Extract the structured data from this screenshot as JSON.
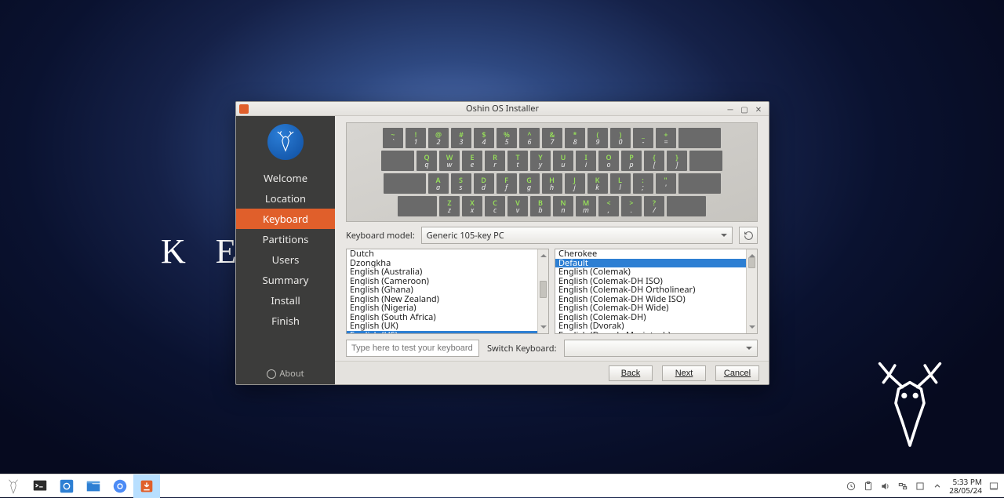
{
  "bgtext": "KE",
  "window": {
    "title": "Oshin OS Installer"
  },
  "sidebar": {
    "steps": [
      "Welcome",
      "Location",
      "Keyboard",
      "Partitions",
      "Users",
      "Summary",
      "Install",
      "Finish"
    ],
    "active_index": 2,
    "about": "About"
  },
  "keyboard_preview": {
    "row1": [
      [
        "~",
        "`"
      ],
      [
        "!",
        "1"
      ],
      [
        "@",
        "2"
      ],
      [
        "#",
        "3"
      ],
      [
        "$",
        "4"
      ],
      [
        "%",
        "5"
      ],
      [
        "^",
        "6"
      ],
      [
        "&",
        "7"
      ],
      [
        "*",
        "8"
      ],
      [
        "(",
        "9"
      ],
      [
        ")",
        "0"
      ],
      [
        "_",
        "-"
      ],
      [
        "+",
        "="
      ]
    ],
    "row2": [
      [
        "Q",
        "q"
      ],
      [
        "W",
        "w"
      ],
      [
        "E",
        "e"
      ],
      [
        "R",
        "r"
      ],
      [
        "T",
        "t"
      ],
      [
        "Y",
        "y"
      ],
      [
        "U",
        "u"
      ],
      [
        "I",
        "i"
      ],
      [
        "O",
        "o"
      ],
      [
        "P",
        "p"
      ],
      [
        "{",
        "["
      ],
      [
        "}",
        "]"
      ]
    ],
    "row3": [
      [
        "A",
        "a"
      ],
      [
        "S",
        "s"
      ],
      [
        "D",
        "d"
      ],
      [
        "F",
        "f"
      ],
      [
        "G",
        "g"
      ],
      [
        "H",
        "h"
      ],
      [
        "J",
        "j"
      ],
      [
        "K",
        "k"
      ],
      [
        "L",
        "l"
      ],
      [
        ":",
        ";"
      ],
      [
        "\"",
        "'"
      ]
    ],
    "row4": [
      [
        "Z",
        "z"
      ],
      [
        "X",
        "x"
      ],
      [
        "C",
        "c"
      ],
      [
        "V",
        "v"
      ],
      [
        "B",
        "b"
      ],
      [
        "N",
        "n"
      ],
      [
        "M",
        "m"
      ],
      [
        "<",
        ","
      ],
      [
        ">",
        "."
      ],
      [
        "?",
        "/"
      ]
    ]
  },
  "model": {
    "label": "Keyboard model:",
    "value": "Generic 105-key PC"
  },
  "layouts": {
    "items": [
      "Dutch",
      "Dzongkha",
      "English (Australia)",
      "English (Cameroon)",
      "English (Ghana)",
      "English (New Zealand)",
      "English (Nigeria)",
      "English (South Africa)",
      "English (UK)",
      "English (US)"
    ],
    "selected_index": 9
  },
  "variants": {
    "items": [
      "Cherokee",
      "Default",
      "English (Colemak)",
      "English (Colemak-DH ISO)",
      "English (Colemak-DH Ortholinear)",
      "English (Colemak-DH Wide ISO)",
      "English (Colemak-DH Wide)",
      "English (Colemak-DH)",
      "English (Dvorak)",
      "English (Dvorak, Macintosh)"
    ],
    "selected_index": 1
  },
  "test": {
    "placeholder": "Type here to test your keyboard",
    "switch_label": "Switch Keyboard:"
  },
  "footer": {
    "back": "Back",
    "next": "Next",
    "cancel": "Cancel"
  },
  "clock": {
    "time": "5:33 PM",
    "date": "28/05/24"
  }
}
